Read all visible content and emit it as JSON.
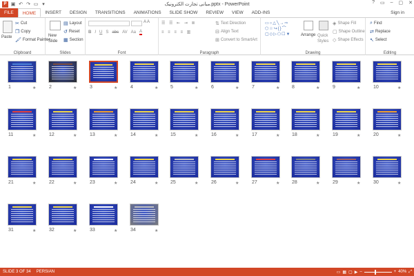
{
  "titlebar": {
    "title": "مبانی تجارت الکترونیک.pptx - PowerPoint",
    "app_icon": "P",
    "qat": [
      "save-icon",
      "undo-icon",
      "redo-icon",
      "slideshow-icon",
      "customize-icon"
    ],
    "controls": [
      "?",
      "▭",
      "–",
      "▢",
      "✕"
    ]
  },
  "tabs": [
    "FILE",
    "HOME",
    "INSERT",
    "DESIGN",
    "TRANSITIONS",
    "ANIMATIONS",
    "SLIDE SHOW",
    "REVIEW",
    "VIEW",
    "ADD-INS"
  ],
  "active_tab": "HOME",
  "signin": "Sign in",
  "ribbon": {
    "clipboard": {
      "label": "Clipboard",
      "paste": "Paste",
      "cut": "Cut",
      "copy": "Copy",
      "format_painter": "Format Painter"
    },
    "slides": {
      "label": "Slides",
      "new_slide": "New Slide",
      "layout": "Layout",
      "reset": "Reset",
      "section": "Section"
    },
    "font": {
      "label": "Font",
      "bold": "B",
      "italic": "I",
      "underline": "U",
      "strike": "S",
      "abc": "abc",
      "av": "AV",
      "aa": "Aa",
      "a_color": "A"
    },
    "paragraph": {
      "label": "Paragraph",
      "text_direction": "Text Direction",
      "align_text": "Align Text",
      "convert_smartart": "Convert to SmartArt"
    },
    "drawing": {
      "label": "Drawing",
      "arrange": "Arrange",
      "quick_styles": "Quick Styles",
      "shape_fill": "Shape Fill",
      "shape_outline": "Shape Outline",
      "shape_effects": "Shape Effects"
    },
    "editing": {
      "label": "Editing",
      "find": "Find",
      "replace": "Replace",
      "select": "Select"
    }
  },
  "slides": [
    {
      "n": "1",
      "bg": "#1c2f8a",
      "accent": "#4a80d4"
    },
    {
      "n": "2",
      "bg": "#2a2a2a",
      "accent": "#7a4a3a"
    },
    {
      "n": "3",
      "bg": "#1a2a9a",
      "accent": "#f4d84a"
    },
    {
      "n": "4",
      "bg": "#1a2a9a",
      "accent": "#f4d84a"
    },
    {
      "n": "5",
      "bg": "#1a2a9a",
      "accent": "#f4d84a"
    },
    {
      "n": "6",
      "bg": "#1a2a9a",
      "accent": "#f4d84a"
    },
    {
      "n": "7",
      "bg": "#1a2a9a",
      "accent": "#f4d84a"
    },
    {
      "n": "8",
      "bg": "#1a2a9a",
      "accent": "#f4d84a"
    },
    {
      "n": "9",
      "bg": "#1a2a9a",
      "accent": "#f4d84a"
    },
    {
      "n": "10",
      "bg": "#1a2a9a",
      "accent": "#f4d84a"
    },
    {
      "n": "11",
      "bg": "#1a2a9a",
      "accent": "#e04040"
    },
    {
      "n": "12",
      "bg": "#1a2a9a",
      "accent": "#f4d84a"
    },
    {
      "n": "13",
      "bg": "#1a2a9a",
      "accent": "#f0a030"
    },
    {
      "n": "14",
      "bg": "#1a2a9a",
      "accent": "#f4d84a"
    },
    {
      "n": "15",
      "bg": "#1a2a9a",
      "accent": "#f4d84a"
    },
    {
      "n": "16",
      "bg": "#1a2a9a",
      "accent": "#f4d84a"
    },
    {
      "n": "17",
      "bg": "#1a2a9a",
      "accent": "#f4d84a"
    },
    {
      "n": "18",
      "bg": "#1a2a9a",
      "accent": "#f4d84a"
    },
    {
      "n": "19",
      "bg": "#1a2a9a",
      "accent": "#f4d84a"
    },
    {
      "n": "20",
      "bg": "#1a2a9a",
      "accent": "#f0a030"
    },
    {
      "n": "21",
      "bg": "#1a2a9a",
      "accent": "#f4d84a"
    },
    {
      "n": "22",
      "bg": "#1a2a9a",
      "accent": "#f4d84a"
    },
    {
      "n": "23",
      "bg": "#1a2a9a",
      "accent": "#ffffff"
    },
    {
      "n": "24",
      "bg": "#1a2a9a",
      "accent": "#f4d84a"
    },
    {
      "n": "25",
      "bg": "#1a2a9a",
      "accent": "#c0c0c0"
    },
    {
      "n": "26",
      "bg": "#1a2a9a",
      "accent": "#f4d84a"
    },
    {
      "n": "27",
      "bg": "#1a2a9a",
      "accent": "#e04040"
    },
    {
      "n": "28",
      "bg": "#1a2a9a",
      "accent": "#808080"
    },
    {
      "n": "29",
      "bg": "#1a2a9a",
      "accent": "#a06060"
    },
    {
      "n": "30",
      "bg": "#1a2a9a",
      "accent": "#f4d84a"
    },
    {
      "n": "31",
      "bg": "#1a2a9a",
      "accent": "#f4d84a"
    },
    {
      "n": "32",
      "bg": "#1a2a9a",
      "accent": "#f4d84a"
    },
    {
      "n": "33",
      "bg": "#1a2a9a",
      "accent": "#ffffff"
    },
    {
      "n": "34",
      "bg": "#7a7a7a",
      "accent": "#c0c0c0"
    }
  ],
  "selected_slide": "3",
  "star": "★",
  "status": {
    "slide_info": "SLIDE 3 OF 34",
    "language": "PERSIAN",
    "zoom": "40%"
  }
}
